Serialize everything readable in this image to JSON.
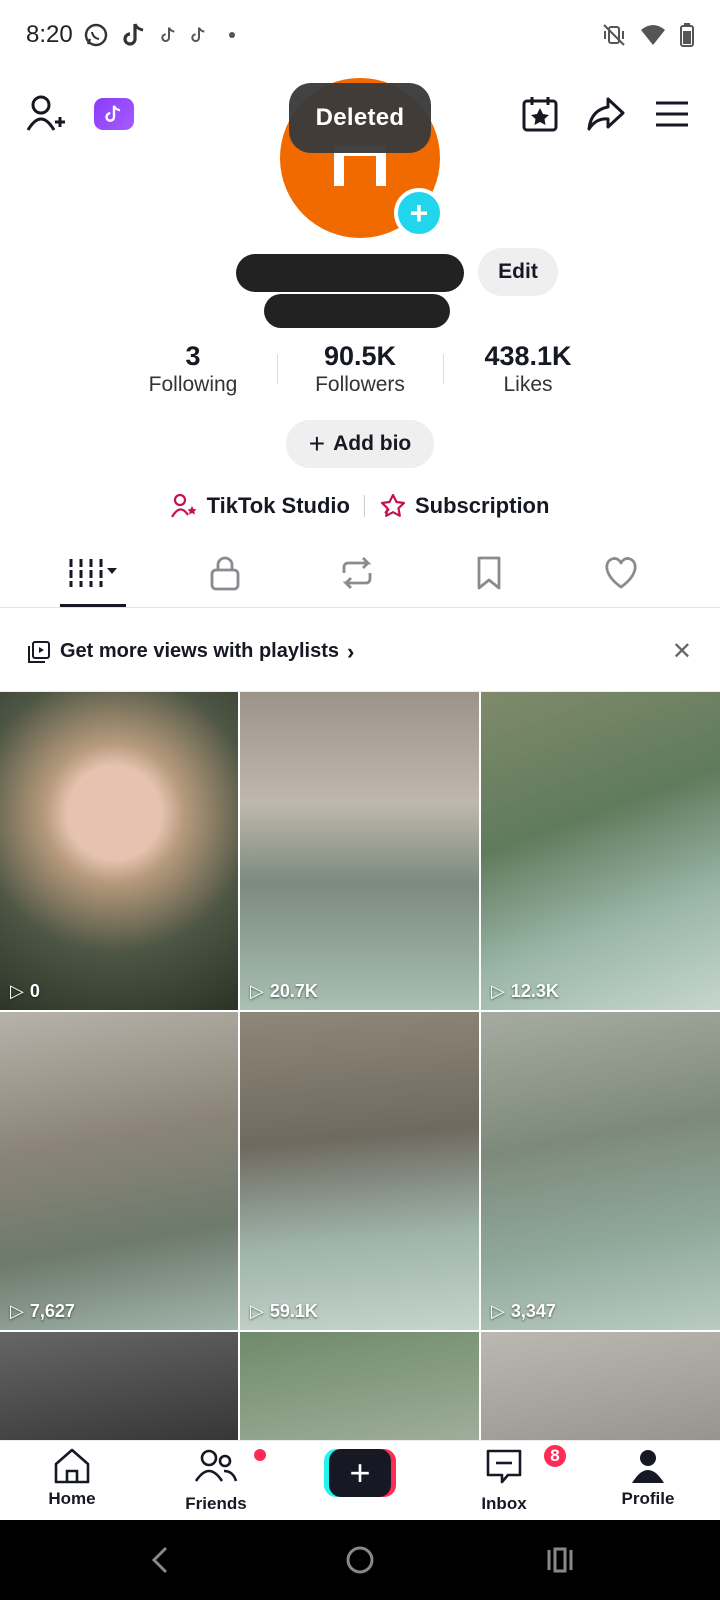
{
  "status_bar": {
    "time": "8:20"
  },
  "toast": {
    "text": "Deleted"
  },
  "profile": {
    "edit_label": "Edit",
    "stats": [
      {
        "value": "3",
        "label": "Following"
      },
      {
        "value": "90.5K",
        "label": "Followers"
      },
      {
        "value": "438.1K",
        "label": "Likes"
      }
    ],
    "add_bio_label": "Add bio",
    "links": [
      {
        "label": "TikTok Studio",
        "icon": "studio-person-icon"
      },
      {
        "label": "Subscription",
        "icon": "subscription-star-icon"
      }
    ]
  },
  "tabs": [
    "videos-grid-icon",
    "lock-icon",
    "repost-icon",
    "bookmark-icon",
    "heart-icon"
  ],
  "banner": {
    "text": "Get more views with playlists"
  },
  "videos": [
    {
      "views": "0"
    },
    {
      "views": "20.7K"
    },
    {
      "views": "12.3K"
    },
    {
      "views": "7,627"
    },
    {
      "views": "59.1K"
    },
    {
      "views": "3,347"
    },
    {
      "views": ""
    },
    {
      "views": ""
    },
    {
      "views": ""
    }
  ],
  "bottom_nav": {
    "home": "Home",
    "friends": "Friends",
    "inbox": "Inbox",
    "inbox_badge": "8",
    "profile": "Profile"
  },
  "colors": {
    "accent_red": "#fe2c55",
    "accent_cyan": "#25f4ee",
    "avatar_orange": "#f06a00"
  }
}
